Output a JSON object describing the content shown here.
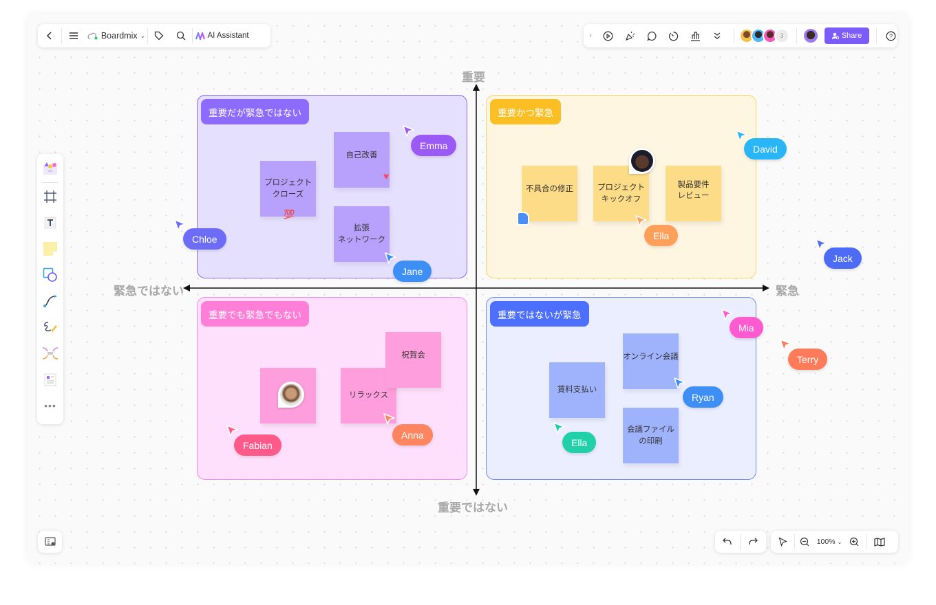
{
  "toolbar_left": {
    "back": "back",
    "menu": "menu",
    "app_name": "Boardmix",
    "tag": "tag",
    "search": "search",
    "ai_label": "AI Assistant"
  },
  "toolbar_right": {
    "collaborator_count": "3",
    "share_label": "Share"
  },
  "zoom": {
    "level": "100%"
  },
  "axes": {
    "top": "重要",
    "bottom": "重要ではない",
    "left": "緊急ではない",
    "right": "緊急"
  },
  "quadrants": {
    "q1": {
      "label": "重要だが緊急ではない",
      "color": "#8e6bff",
      "bg": "#e6e0ff",
      "notes": [
        "プロジェクト\nクローズ",
        "自己改善",
        "拡張\nネットワーク"
      ],
      "reactions": [
        "💯",
        "❤️"
      ]
    },
    "q2": {
      "label": "重要かつ緊急",
      "color": "#fbbf24",
      "bg": "#fff6e2",
      "notes": [
        "不具合の修正",
        "プロジェクト\nキックオフ",
        "製品要件\nレビュー"
      ],
      "reactions": [
        "👍"
      ]
    },
    "q3": {
      "label": "重要でも緊急でもない",
      "color": "#ff7fd8",
      "bg": "#ffe0fc",
      "notes": [
        "",
        "リラックス",
        "祝賀会"
      ]
    },
    "q4": {
      "label": "重要ではないが緊急",
      "color": "#4c6fff",
      "bg": "#ebeeff",
      "notes": [
        "賃料支払い",
        "オンライン会議",
        "会議ファイル\nの印刷"
      ]
    }
  },
  "cursors": [
    {
      "name": "Emma",
      "color": "#9b59f5"
    },
    {
      "name": "Chloe",
      "color": "#6c6cf6"
    },
    {
      "name": "Jane",
      "color": "#3d8ff5"
    },
    {
      "name": "David",
      "color": "#29b6f6"
    },
    {
      "name": "Ella",
      "color": "#ff9f5a"
    },
    {
      "name": "Jack",
      "color": "#4d6cf5"
    },
    {
      "name": "Mia",
      "color": "#ff5ad0"
    },
    {
      "name": "Terry",
      "color": "#ff7b5a"
    },
    {
      "name": "Fabian",
      "color": "#ff5a8a"
    },
    {
      "name": "Anna",
      "color": "#ff8460"
    },
    {
      "name": "Ryan",
      "color": "#3d8ff5"
    },
    {
      "name": "Ella",
      "color": "#20d0a8"
    }
  ]
}
